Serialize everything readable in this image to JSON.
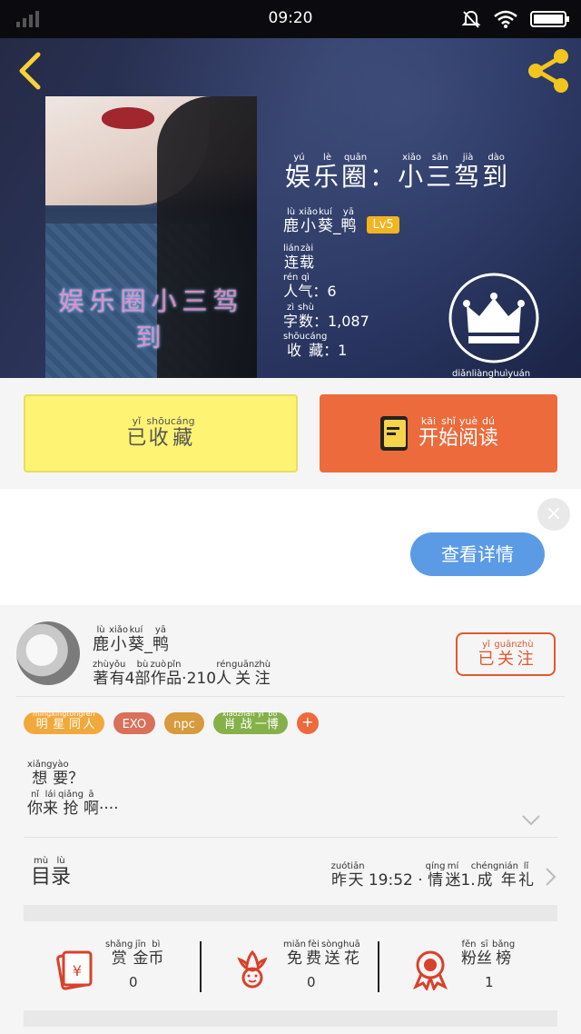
{
  "status_bar": {
    "time": "09:20"
  },
  "book": {
    "title_chars": [
      {
        "c": "娱",
        "p": "yú"
      },
      {
        "c": "乐",
        "p": "lè"
      },
      {
        "c": "圈",
        "p": "quān"
      },
      {
        "c": "：",
        "p": ""
      },
      {
        "c": "小",
        "p": "xiǎo"
      },
      {
        "c": "三",
        "p": "sān"
      },
      {
        "c": "驾",
        "p": "jià"
      },
      {
        "c": "到",
        "p": "dào"
      }
    ],
    "cover_text": "娱乐圈小三驾到",
    "author_chars": [
      {
        "c": "鹿",
        "p": "lù"
      },
      {
        "c": "小",
        "p": "xiǎo"
      },
      {
        "c": "葵",
        "p": "kuí"
      },
      {
        "c": "_",
        "p": ""
      },
      {
        "c": "鸭",
        "p": "yā"
      }
    ],
    "level": "Lv5",
    "status_chars": [
      {
        "c": "连",
        "p": "lián"
      },
      {
        "c": "载",
        "p": "zài"
      }
    ],
    "popularity_label": [
      {
        "c": "人",
        "p": "rén"
      },
      {
        "c": "气",
        "p": "qì"
      }
    ],
    "popularity_value": "：6",
    "words_label": [
      {
        "c": "字",
        "p": "zì"
      },
      {
        "c": "数",
        "p": "shù"
      }
    ],
    "words_value": "：1,087",
    "favorites_label": [
      {
        "c": "收",
        "p": "shōu"
      },
      {
        "c": "藏",
        "p": "cáng"
      }
    ],
    "favorites_value": "：1"
  },
  "vip": {
    "label_chars": [
      {
        "c": "点",
        "p": "diǎn"
      },
      {
        "c": "亮",
        "p": "liàng"
      },
      {
        "c": "会",
        "p": "huì"
      },
      {
        "c": "员",
        "p": "yuán"
      }
    ]
  },
  "actions": {
    "collected_chars": [
      {
        "c": "已",
        "p": "yǐ"
      },
      {
        "c": "收",
        "p": "shōu"
      },
      {
        "c": "藏",
        "p": "cáng"
      }
    ],
    "read_chars": [
      {
        "c": "开",
        "p": "kāi"
      },
      {
        "c": "始",
        "p": "shǐ"
      },
      {
        "c": "阅",
        "p": "yuè"
      },
      {
        "c": "读",
        "p": "dú"
      }
    ]
  },
  "ad": {
    "detail_label": "查看详情",
    "close_label": "×"
  },
  "author_card": {
    "name_chars": [
      {
        "c": "鹿",
        "p": "lù"
      },
      {
        "c": "小",
        "p": "xiǎo"
      },
      {
        "c": "葵",
        "p": "kuí"
      },
      {
        "c": "_",
        "p": ""
      },
      {
        "c": "鸭",
        "p": "yā"
      }
    ],
    "stats_chars": [
      {
        "c": "著",
        "p": "zhù"
      },
      {
        "c": "有",
        "p": "yǒu"
      },
      {
        "c": "4",
        "p": ""
      },
      {
        "c": "部",
        "p": "bù"
      },
      {
        "c": "作",
        "p": "zuò"
      },
      {
        "c": "品",
        "p": "pǐn"
      },
      {
        "c": "·210",
        "p": ""
      },
      {
        "c": "人",
        "p": "rén"
      },
      {
        "c": "关",
        "p": "guān"
      },
      {
        "c": "注",
        "p": "zhù"
      }
    ],
    "follow_chars": [
      {
        "c": "已",
        "p": "yǐ"
      },
      {
        "c": "关",
        "p": "guān"
      },
      {
        "c": "注",
        "p": "zhù"
      }
    ]
  },
  "tags": [
    {
      "chars": [
        {
          "c": "明",
          "p": "míng"
        },
        {
          "c": "星",
          "p": "xīng"
        },
        {
          "c": "同",
          "p": "tóng"
        },
        {
          "c": "人",
          "p": "rén"
        }
      ],
      "color": "#f2a93b"
    },
    {
      "chars": [
        {
          "c": "EXO",
          "p": ""
        }
      ],
      "color": "#d9705a"
    },
    {
      "chars": [
        {
          "c": "npc",
          "p": ""
        }
      ],
      "color": "#d79a3c"
    },
    {
      "chars": [
        {
          "c": "肖",
          "p": "xiào"
        },
        {
          "c": "战",
          "p": "zhàn"
        },
        {
          "c": "一",
          "p": "yī"
        },
        {
          "c": "博",
          "p": "bó"
        }
      ],
      "color": "#86b04a"
    }
  ],
  "tag_add_label": "+",
  "intro": {
    "line1": [
      {
        "c": "想",
        "p": "xiǎng"
      },
      {
        "c": "要",
        "p": "yào"
      },
      {
        "c": "？",
        "p": ""
      }
    ],
    "line2": [
      {
        "c": "你",
        "p": "nǐ"
      },
      {
        "c": "来",
        "p": "lái"
      },
      {
        "c": "抢",
        "p": "qiǎng"
      },
      {
        "c": "啊",
        "p": "ā"
      },
      {
        "c": "····",
        "p": ""
      }
    ]
  },
  "toc": {
    "label_chars": [
      {
        "c": "目",
        "p": "mù"
      },
      {
        "c": "录",
        "p": "lù"
      }
    ],
    "latest_chars": [
      {
        "c": "昨",
        "p": "zuó"
      },
      {
        "c": "天",
        "p": "tiān"
      },
      {
        "c": " 19:52 · ",
        "p": ""
      },
      {
        "c": "情",
        "p": "qíng"
      },
      {
        "c": "迷",
        "p": "mí"
      },
      {
        "c": "1.",
        "p": ""
      },
      {
        "c": "成",
        "p": "chéng"
      },
      {
        "c": "年",
        "p": "nián"
      },
      {
        "c": "礼",
        "p": "lǐ"
      }
    ]
  },
  "support": [
    {
      "chars": [
        {
          "c": "赏",
          "p": "shǎng"
        },
        {
          "c": "金",
          "p": "jīn"
        },
        {
          "c": "币",
          "p": "bì"
        }
      ],
      "count": "0",
      "icon": "red-envelope-icon"
    },
    {
      "chars": [
        {
          "c": "免",
          "p": "miǎn"
        },
        {
          "c": "费",
          "p": "fèi"
        },
        {
          "c": "送",
          "p": "sòng"
        },
        {
          "c": "花",
          "p": "huā"
        }
      ],
      "count": "0",
      "icon": "flower-icon"
    },
    {
      "chars": [
        {
          "c": "粉",
          "p": "fěn"
        },
        {
          "c": "丝",
          "p": "sī"
        },
        {
          "c": "榜",
          "p": "bǎng"
        }
      ],
      "count": "1",
      "icon": "medal-icon"
    }
  ],
  "colors": {
    "accent_orange": "#ec6a3c",
    "accent_yellow": "#fff374",
    "detail_blue": "#5b9be6",
    "icon_red": "#d8412b",
    "icon_gold": "#f2c51f"
  }
}
